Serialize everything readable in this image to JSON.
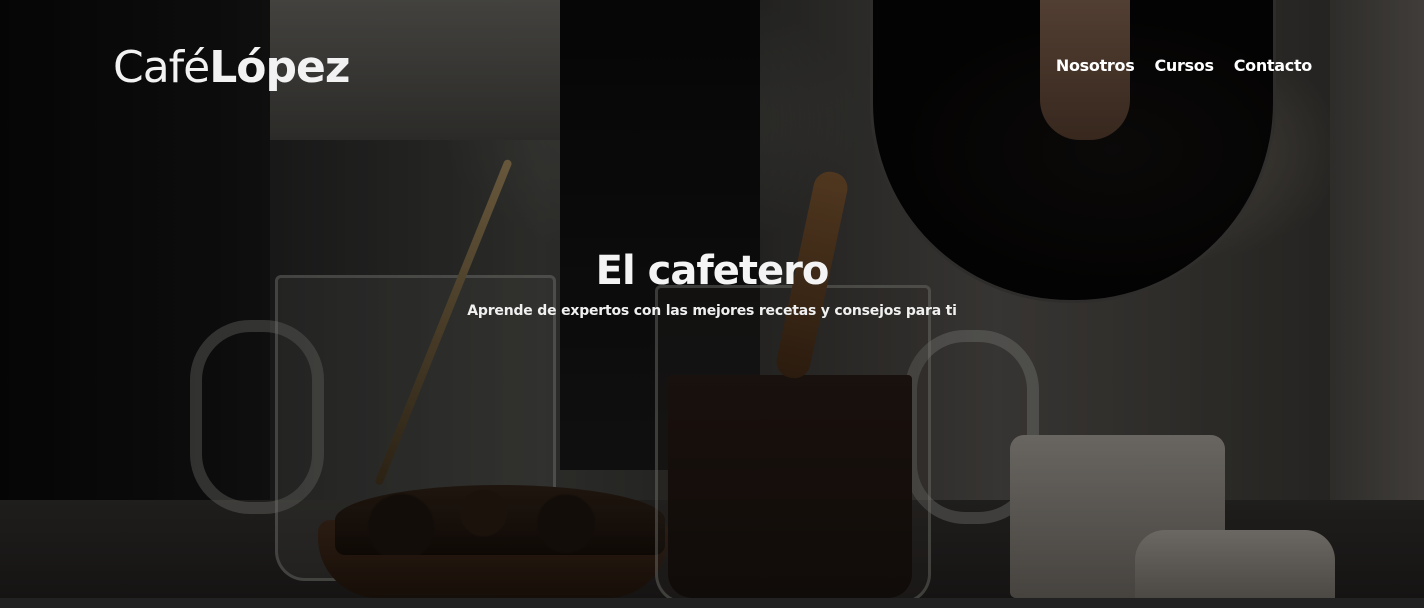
{
  "header": {
    "logo_light": "Café",
    "logo_bold": "López",
    "nav": [
      {
        "label": "Nosotros"
      },
      {
        "label": "Cursos"
      },
      {
        "label": "Contacto"
      }
    ]
  },
  "hero": {
    "title": "El cafetero",
    "subtitle": "Aprende de expertos con las mejores recetas y consejos para ti",
    "image": "coffee-pouring-photo"
  },
  "colors": {
    "text": "#ffffff",
    "footer_bar": "#222222"
  }
}
